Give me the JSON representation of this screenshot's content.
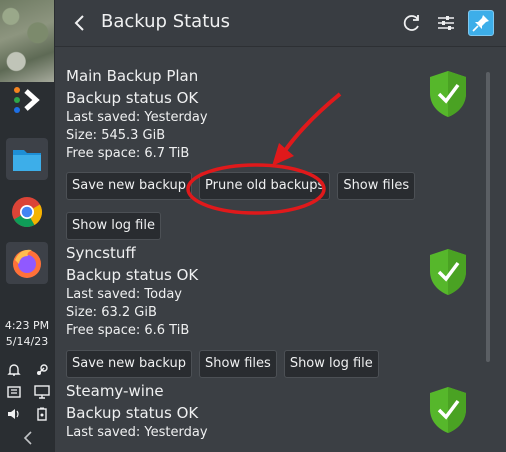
{
  "window": {
    "title": "Backup Status"
  },
  "header_icons": [
    "back-icon",
    "refresh-icon",
    "settings-sliders-icon",
    "pin-icon"
  ],
  "taskbar": {
    "time": "4:23 PM",
    "date": "5/14/23",
    "apps": [
      "kickoff-icon",
      "files-icon",
      "chrome-icon",
      "firefox-icon"
    ],
    "tray": [
      "bell-icon",
      "steam-icon",
      "clipboard-icon",
      "display-icon",
      "volume-icon",
      "battery-icon"
    ],
    "expand": "chevron-left-icon"
  },
  "plans": [
    {
      "name": "Main Backup Plan",
      "status": "Backup status OK",
      "last_saved": "Last saved: Yesterday",
      "size": "Size: 545.3 GiB",
      "free": "Free space: 6.7 TiB",
      "buttons": [
        "Save new backup",
        "Prune old backups",
        "Show files",
        "Show log file"
      ]
    },
    {
      "name": "Syncstuff",
      "status": "Backup status OK",
      "last_saved": "Last saved: Today",
      "size": "Size: 63.2 GiB",
      "free": "Free space: 6.6 TiB",
      "buttons": [
        "Save new backup",
        "Show files",
        "Show log file"
      ]
    },
    {
      "name": "Steamy-wine",
      "status": "Backup status OK",
      "last_saved": "Last saved: Yesterday"
    }
  ],
  "colors": {
    "shield_green": "#56b72b",
    "annotation_red": "#e0191b",
    "accent": "#3daee9"
  }
}
